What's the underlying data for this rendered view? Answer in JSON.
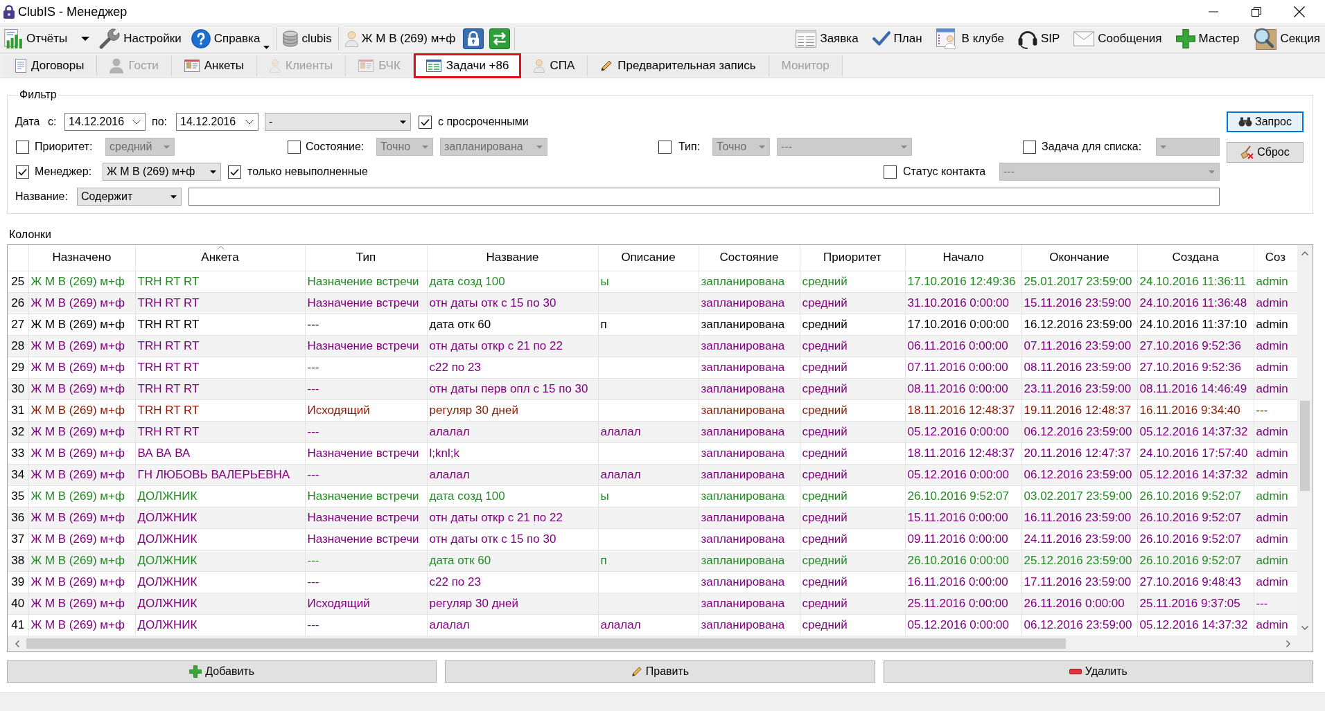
{
  "window": {
    "title": "ClubIS - Менеджер"
  },
  "toolbar": {
    "groups": [
      [
        {
          "label": "Отчёты",
          "kind": "split"
        },
        {
          "label": "Настройки",
          "kind": "button"
        },
        {
          "label": "Справка",
          "kind": "menu"
        }
      ],
      [
        {
          "label": "clubis",
          "kind": "button"
        }
      ],
      [
        {
          "label": "Ж М В (269) м+ф",
          "kind": "button"
        }
      ]
    ],
    "right": [
      {
        "label": "Заявка"
      },
      {
        "label": "План"
      },
      {
        "label": "В клубе"
      },
      {
        "label": "SIP"
      },
      {
        "label": "Сообщения"
      },
      {
        "label": "Мастер"
      },
      {
        "label": "Секция"
      }
    ]
  },
  "tabs": [
    {
      "label": "Договоры",
      "selected": false,
      "disabled": false
    },
    {
      "label": "Гости",
      "selected": false,
      "disabled": true
    },
    {
      "label": "Анкеты",
      "selected": false,
      "disabled": false
    },
    {
      "label": "Клиенты",
      "selected": false,
      "disabled": true
    },
    {
      "label": "БЧК",
      "selected": false,
      "disabled": true
    },
    {
      "label": "Задачи +86",
      "selected": true,
      "disabled": false
    },
    {
      "label": "СПА",
      "selected": false,
      "disabled": false
    },
    {
      "label": "Предварительная запись",
      "selected": false,
      "disabled": false
    },
    {
      "label": "Монитор",
      "selected": false,
      "disabled": true
    }
  ],
  "filter": {
    "title": "Фильтр",
    "date": {
      "label": "Дата",
      "from_label": "с:",
      "from": "14.12.2016",
      "to_label": "по:",
      "to": "14.12.2016",
      "period": "-"
    },
    "overdue": {
      "label": "с просроченными",
      "checked": true
    },
    "priority": {
      "label": "Приоритет:",
      "checked": false,
      "value": "средний"
    },
    "state": {
      "label": "Состояние:",
      "checked": false,
      "match": "Точно",
      "value": "запланирована"
    },
    "type": {
      "label": "Тип:",
      "checked": false,
      "match": "Точно",
      "value": "---"
    },
    "list_task": {
      "label": "Задача для списка:",
      "checked": false
    },
    "manager": {
      "label": "Менеджер:",
      "checked": true,
      "value": "Ж М В (269) м+ф"
    },
    "incomplete_only": {
      "label": "только невыполненные",
      "checked": true
    },
    "contact_status": {
      "label": "Статус контакта",
      "checked": false,
      "value": "---"
    },
    "name": {
      "label": "Название:",
      "mode": "Содержит"
    },
    "buttons": [
      {
        "label": "Запрос",
        "focused": true
      },
      {
        "label": "Сброс",
        "focused": false
      }
    ]
  },
  "table": {
    "caption": "Колонки",
    "columns": [
      {
        "label": "Назначено",
        "sorted": false
      },
      {
        "label": "Анкета",
        "sorted": true
      },
      {
        "label": "Тип",
        "sorted": false
      },
      {
        "label": "Название",
        "sorted": false
      },
      {
        "label": "Описание",
        "sorted": false
      },
      {
        "label": "Состояние",
        "sorted": false
      },
      {
        "label": "Приоритет",
        "sorted": false
      },
      {
        "label": "Начало",
        "sorted": false
      },
      {
        "label": "Окончание",
        "sorted": false
      },
      {
        "label": "Создана",
        "sorted": false
      },
      {
        "label": "Соз",
        "sorted": false
      }
    ],
    "rows": [
      {
        "number": "25",
        "color": "#228b22",
        "assigned": "Ж М В (269) м+ф",
        "profile": "TRH RT RT",
        "type": "Назначение встречи",
        "title": "дата созд 100",
        "description": "ы",
        "state": "запланирована",
        "priority": "средний",
        "start": "17.10.2016 12:49:36",
        "end": "25.01.2017 23:59:00",
        "created": "24.10.2016 11:36:11",
        "column_11": "admin"
      },
      {
        "number": "26",
        "color": "#800080",
        "assigned": "Ж М В (269) м+ф",
        "profile": "TRH RT RT",
        "type": "Назначение встречи",
        "title": "отн даты отк с 15 по 30",
        "state": "запланирована",
        "priority": "средний",
        "start": "31.10.2016 0:00:00",
        "end": "15.11.2016 23:59:00",
        "created": "24.10.2016 11:36:48",
        "column_11": "admin"
      },
      {
        "number": "27",
        "color": "#000000",
        "assigned": "Ж М В (269) м+ф",
        "profile": "TRH RT RT",
        "type": "---",
        "title": "дата отк 60",
        "description": "п",
        "state": "запланирована",
        "priority": "средний",
        "start": "17.10.2016 0:00:00",
        "end": "16.12.2016 23:59:00",
        "created": "24.10.2016 11:37:10",
        "column_11": "admin"
      },
      {
        "number": "28",
        "color": "#800080",
        "assigned": "Ж М В (269) м+ф",
        "profile": "TRH RT RT",
        "type": "Назначение встречи",
        "title": "отн даты откр с 21 по 22",
        "state": "запланирована",
        "priority": "средний",
        "start": "06.11.2016 0:00:00",
        "end": "07.11.2016 23:59:00",
        "created": "27.10.2016 9:52:36",
        "column_11": "admin"
      },
      {
        "number": "29",
        "color": "#800080",
        "assigned": "Ж М В (269) м+ф",
        "profile": "TRH RT RT",
        "type": "---",
        "title": "с22 по 23",
        "state": "запланирована",
        "priority": "средний",
        "start": "07.11.2016 0:00:00",
        "end": "08.11.2016 23:59:00",
        "created": "27.10.2016 9:52:36",
        "column_11": "admin"
      },
      {
        "number": "30",
        "color": "#800080",
        "assigned": "Ж М В (269) м+ф",
        "profile": "TRH RT RT",
        "type": "---",
        "title": "отн даты перв опл с 15 по 30",
        "state": "запланирована",
        "priority": "средний",
        "start": "08.11.2016 0:00:00",
        "end": "23.11.2016 23:59:00",
        "created": "08.11.2016 14:46:49",
        "column_11": "admin"
      },
      {
        "number": "31",
        "color": "#8b1a00",
        "assigned": "Ж М В (269) м+ф",
        "profile": "TRH RT RT",
        "type": "Исходящий",
        "title": "регуляр 30 дней",
        "state": "запланирована",
        "priority": "средний",
        "start": "18.11.2016 12:48:37",
        "end": "19.11.2016 12:48:37",
        "created": "16.11.2016 9:34:40",
        "column_11": "---"
      },
      {
        "number": "32",
        "color": "#800080",
        "assigned": "Ж М В (269) м+ф",
        "profile": "TRH RT RT",
        "type": "---",
        "title": "алалал",
        "description": "алалал",
        "state": "запланирована",
        "priority": "средний",
        "start": "05.12.2016 0:00:00",
        "end": "06.12.2016 23:59:00",
        "created": "05.12.2016 14:37:32",
        "column_11": "admin"
      },
      {
        "number": "33",
        "color": "#800080",
        "assigned": "Ж М В (269) м+ф",
        "profile": "ВА ВА ВА",
        "type": "Назначение встречи",
        "title": "l;knl;k",
        "state": "запланирована",
        "priority": "средний",
        "start": "18.11.2016 12:48:37",
        "end": "20.11.2016 12:47:37",
        "created": "24.10.2016 17:57:40",
        "column_11": "admin"
      },
      {
        "number": "34",
        "color": "#800080",
        "assigned": "Ж М В (269) м+ф",
        "profile": "ГН ЛЮБОВЬ ВАЛЕРЬЕВНА",
        "type": "---",
        "title": "алалал",
        "description": "алалал",
        "state": "запланирована",
        "priority": "средний",
        "start": "05.12.2016 0:00:00",
        "end": "06.12.2016 23:59:00",
        "created": "05.12.2016 14:37:32",
        "column_11": "admin"
      },
      {
        "number": "35",
        "color": "#228b22",
        "assigned": "Ж М В (269) м+ф",
        "profile": "ДОЛЖНИК",
        "type": "Назначение встречи",
        "title": "дата созд 100",
        "description": "ы",
        "state": "запланирована",
        "priority": "средний",
        "start": "26.10.2016 9:52:07",
        "end": "03.02.2017 23:59:00",
        "created": "26.10.2016 9:52:07",
        "column_11": "admin"
      },
      {
        "number": "36",
        "color": "#800080",
        "assigned": "Ж М В (269) м+ф",
        "profile": "ДОЛЖНИК",
        "type": "Назначение встречи",
        "title": "отн даты откр с 21 по 22",
        "state": "запланирована",
        "priority": "средний",
        "start": "15.11.2016 0:00:00",
        "end": "16.11.2016 23:59:00",
        "created": "26.10.2016 9:52:07",
        "column_11": "admin"
      },
      {
        "number": "37",
        "color": "#800080",
        "assigned": "Ж М В (269) м+ф",
        "profile": "ДОЛЖНИК",
        "type": "Назначение встречи",
        "title": "отн даты отк с 15 по 30",
        "state": "запланирована",
        "priority": "средний",
        "start": "09.11.2016 0:00:00",
        "end": "24.11.2016 23:59:00",
        "created": "26.10.2016 9:52:07",
        "column_11": "admin"
      },
      {
        "number": "38",
        "color": "#228b22",
        "assigned": "Ж М В (269) м+ф",
        "profile": "ДОЛЖНИК",
        "type": "---",
        "title": "дата отк 60",
        "description": "п",
        "state": "запланирована",
        "priority": "средний",
        "start": "26.10.2016 0:00:00",
        "end": "25.12.2016 23:59:00",
        "created": "26.10.2016 9:52:07",
        "column_11": "admin"
      },
      {
        "number": "39",
        "color": "#800080",
        "assigned": "Ж М В (269) м+ф",
        "profile": "ДОЛЖНИК",
        "type": "---",
        "title": "с22 по 23",
        "state": "запланирована",
        "priority": "средний",
        "start": "16.11.2016 0:00:00",
        "end": "17.11.2016 23:59:00",
        "created": "27.10.2016 9:48:43",
        "column_11": "admin"
      },
      {
        "number": "40",
        "color": "#800080",
        "assigned": "Ж М В (269) м+ф",
        "profile": "ДОЛЖНИК",
        "type": "Исходящий",
        "title": "регуляр 30 дней",
        "state": "запланирована",
        "priority": "средний",
        "start": "25.11.2016 0:00:00",
        "end": "26.11.2016 0:00:00",
        "created": "25.11.2016 9:37:05",
        "column_11": "---"
      },
      {
        "number": "41",
        "color": "#800080",
        "assigned": "Ж М В (269) м+ф",
        "profile": "ДОЛЖНИК",
        "type": "---",
        "title": "алалал",
        "description": "алалал",
        "state": "запланирована",
        "priority": "средний",
        "start": "05.12.2016 0:00:00",
        "end": "06.12.2016 23:59:00",
        "created": "05.12.2016 14:37:32",
        "column_11": "admin"
      }
    ]
  },
  "actions": [
    {
      "label": "Добавить"
    },
    {
      "label": "Править"
    },
    {
      "label": "Удалить"
    }
  ]
}
